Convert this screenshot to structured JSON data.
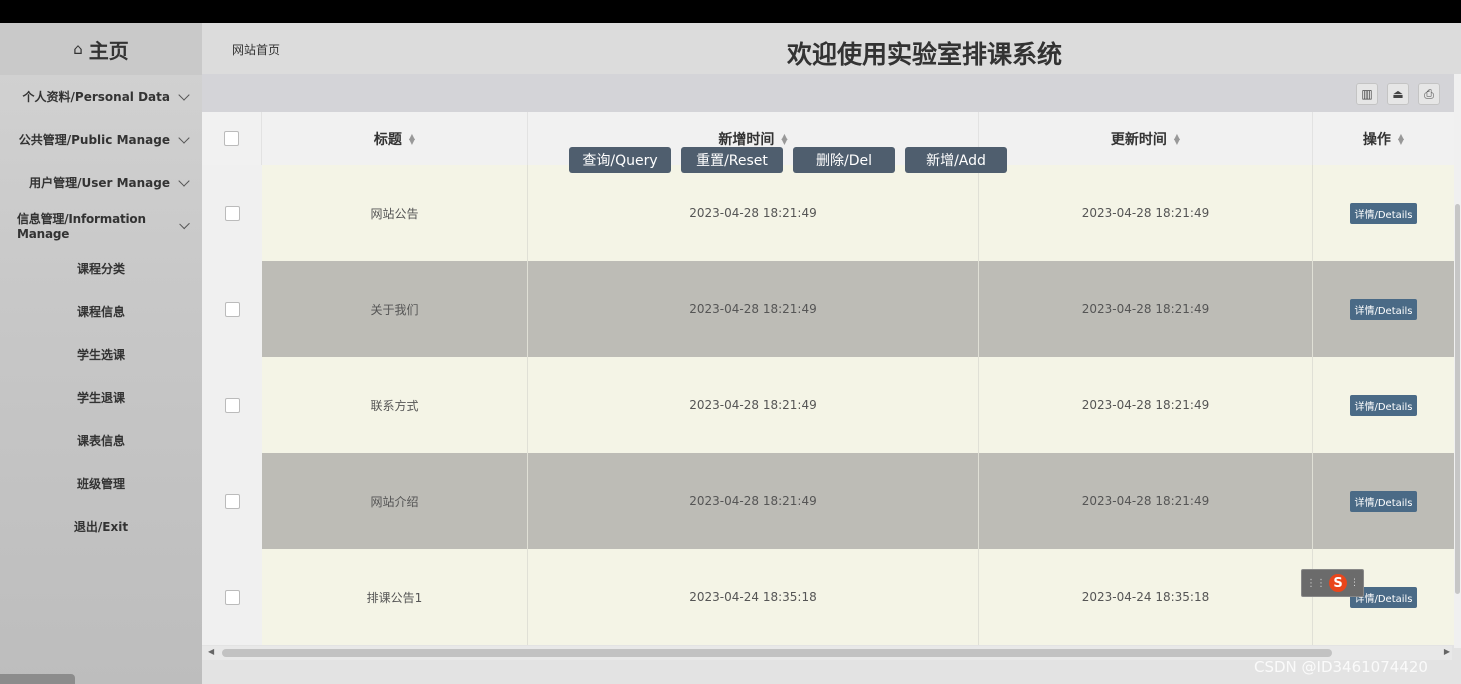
{
  "sidebar": {
    "home": {
      "icon": "home-icon",
      "label": "主页"
    },
    "menu": [
      {
        "label": "个人资料/Personal Data"
      },
      {
        "label": "公共管理/Public Manage"
      },
      {
        "label": "用户管理/User Manage"
      },
      {
        "label": "信息管理/Information Manage"
      }
    ],
    "submenu": [
      {
        "label": "课程分类"
      },
      {
        "label": "课程信息"
      },
      {
        "label": "学生选课"
      },
      {
        "label": "学生退课"
      },
      {
        "label": "课表信息"
      },
      {
        "label": "班级管理"
      },
      {
        "label": "退出/Exit"
      }
    ]
  },
  "header": {
    "breadcrumb": "网站首页",
    "title": "欢迎使用实验室排课系统"
  },
  "toolbar": {
    "icons": [
      "columns-icon",
      "export-icon",
      "print-icon"
    ],
    "actions": {
      "query": "查询/Query",
      "reset": "重置/Reset",
      "delete": "删除/Del",
      "add": "新增/Add"
    }
  },
  "table": {
    "columns": [
      "标题",
      "新增时间",
      "更新时间",
      "操作"
    ],
    "rows": [
      {
        "title": "网站公告",
        "created": "2023-04-28 18:21:49",
        "updated": "2023-04-28 18:21:49",
        "action": "详情/Details"
      },
      {
        "title": "关于我们",
        "created": "2023-04-28 18:21:49",
        "updated": "2023-04-28 18:21:49",
        "action": "详情/Details"
      },
      {
        "title": "联系方式",
        "created": "2023-04-28 18:21:49",
        "updated": "2023-04-28 18:21:49",
        "action": "详情/Details"
      },
      {
        "title": "网站介绍",
        "created": "2023-04-28 18:21:49",
        "updated": "2023-04-28 18:21:49",
        "action": "详情/Details"
      },
      {
        "title": "排课公告1",
        "created": "2023-04-24 18:35:18",
        "updated": "2023-04-24 18:35:18",
        "action": "详情/Details"
      }
    ],
    "row_colors": [
      "#f4f4e6",
      "#bdbcb6"
    ]
  },
  "ime_label": "S",
  "watermark": "CSDN @ID3461074420"
}
